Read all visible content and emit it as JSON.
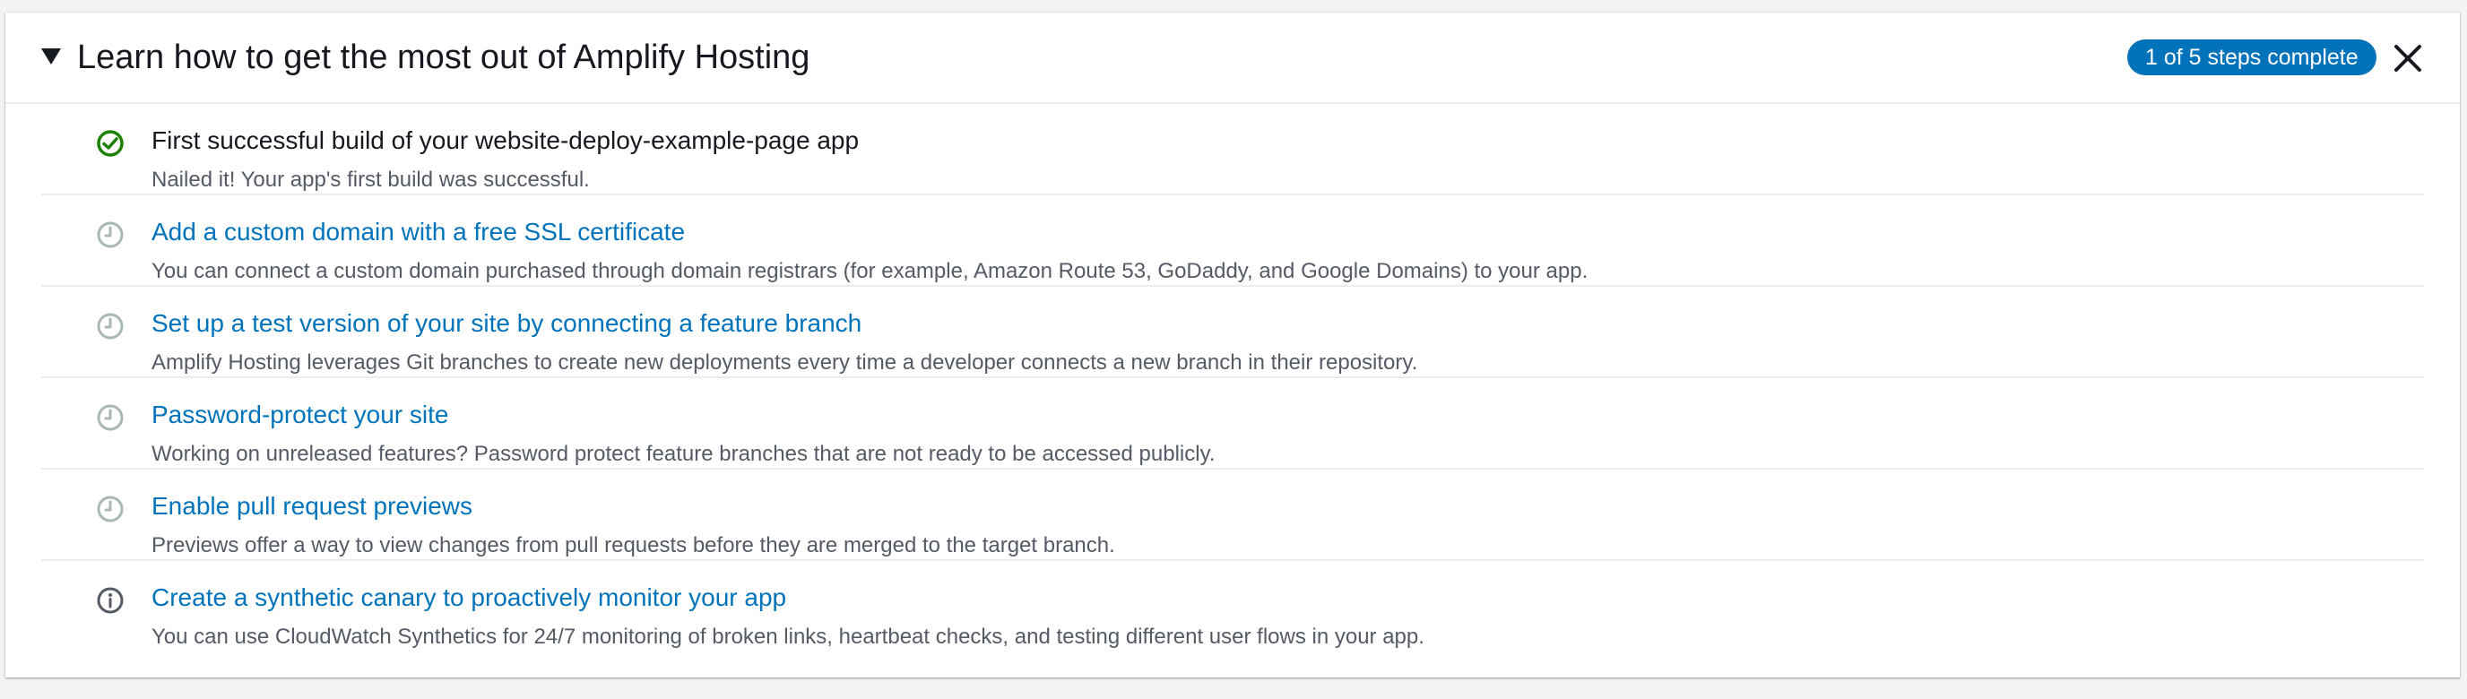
{
  "header": {
    "title": "Learn how to get the most out of Amplify Hosting",
    "progress_badge": "1 of 5 steps complete"
  },
  "colors": {
    "accent": "#0073bb",
    "success": "#1d8102",
    "pending": "#aab7b8",
    "info": "#545b64"
  },
  "steps": [
    {
      "status": "complete",
      "icon": "check-circle-icon",
      "title": "First successful build of your website-deploy-example-page app",
      "description": "Nailed it! Your app's first build was successful."
    },
    {
      "status": "pending",
      "icon": "clock-icon",
      "title": "Add a custom domain with a free SSL certificate",
      "description": "You can connect a custom domain purchased through domain registrars (for example, Amazon Route 53, GoDaddy, and Google Domains) to your app."
    },
    {
      "status": "pending",
      "icon": "clock-icon",
      "title": "Set up a test version of your site by connecting a feature branch",
      "description": "Amplify Hosting leverages Git branches to create new deployments every time a developer connects a new branch in their repository."
    },
    {
      "status": "pending",
      "icon": "clock-icon",
      "title": "Password-protect your site",
      "description": "Working on unreleased features? Password protect feature branches that are not ready to be accessed publicly."
    },
    {
      "status": "pending",
      "icon": "clock-icon",
      "title": "Enable pull request previews",
      "description": "Previews offer a way to view changes from pull requests before they are merged to the target branch."
    },
    {
      "status": "info",
      "icon": "info-circle-icon",
      "title": "Create a synthetic canary to proactively monitor your app",
      "description": "You can use CloudWatch Synthetics for 24/7 monitoring of broken links, heartbeat checks, and testing different user flows in your app."
    }
  ]
}
